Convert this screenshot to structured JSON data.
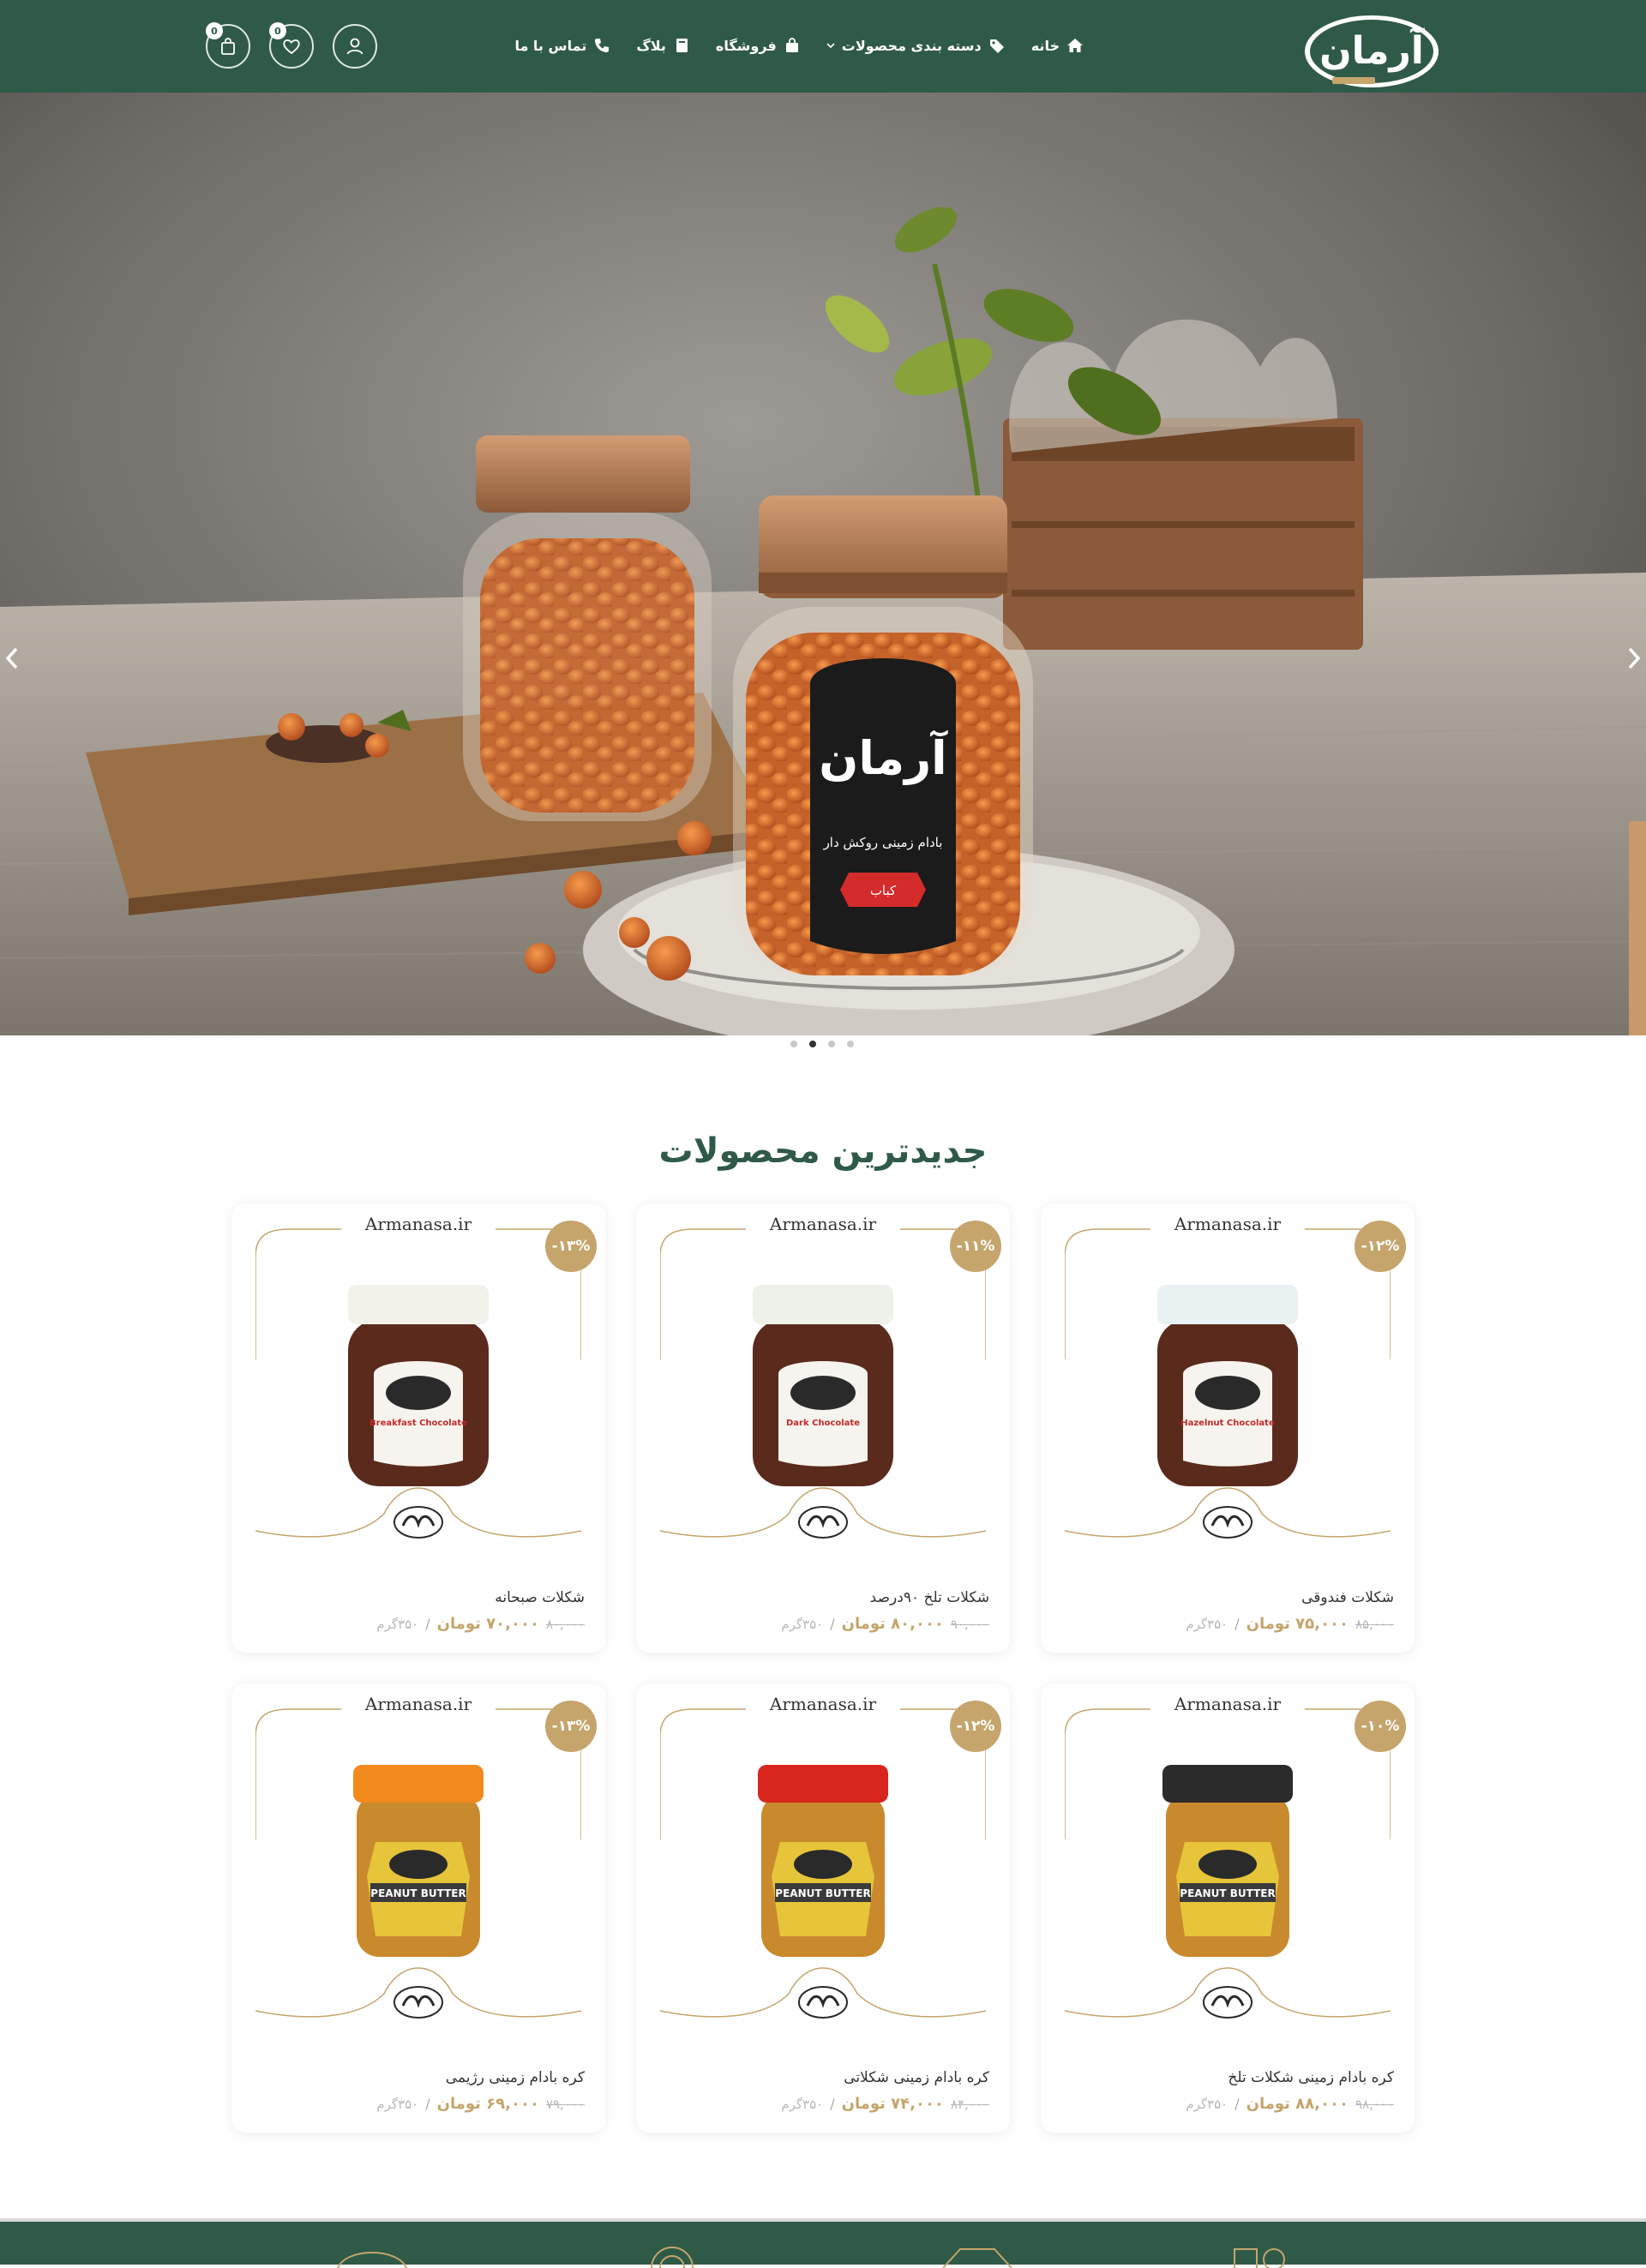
{
  "header": {
    "logo_text": "آرمان",
    "nav": [
      {
        "label": "خانه",
        "icon": "home-icon"
      },
      {
        "label": "دسته بندی محصولات",
        "icon": "tags-icon"
      },
      {
        "label": "فروشگاه",
        "icon": "shopping-bag-icon"
      },
      {
        "label": "بلاگ",
        "icon": "book-icon"
      },
      {
        "label": "تماس با ما",
        "icon": "phone-icon"
      }
    ],
    "wishlist_count": "0",
    "cart_count": "0"
  },
  "hero": {
    "jar_brand": "آرمان",
    "jar_subtitle": "بادام زمینی روکش دار",
    "jar_tag": "کباب",
    "slide_count": 4,
    "active_slide": 2
  },
  "section": {
    "title": "جدیدترین محصولات"
  },
  "products": [
    {
      "name": "شکلات فندوقی",
      "site": "Armanasa.ir",
      "discount": "-۱۲%",
      "old_price": "۸۵,۰۰۰",
      "new_price": "۷۵,۰۰۰ تومان",
      "weight": "۳۵۰گرم",
      "jar": "chocolate",
      "jar_label": "Hazelnut Chocolate",
      "cap_color": "#e9f1f3"
    },
    {
      "name": "شکلات تلخ ۹۰درصد",
      "site": "Armanasa.ir",
      "discount": "-۱۱%",
      "old_price": "۹۰,۰۰۰",
      "new_price": "۸۰,۰۰۰ تومان",
      "weight": "۳۵۰گرم",
      "jar": "chocolate",
      "jar_label": "Dark Chocolate",
      "cap_color": "#eef1ea"
    },
    {
      "name": "شکلات صبحانه",
      "site": "Armanasa.ir",
      "discount": "-۱۳%",
      "old_price": "۸۰,۰۰۰",
      "new_price": "۷۰,۰۰۰ تومان",
      "weight": "۳۵۰گرم",
      "jar": "chocolate",
      "jar_label": "Breakfast Chocolate",
      "cap_color": "#f2f2ea"
    },
    {
      "name": "کره بادام زمینی شکلات تلخ",
      "site": "Armanasa.ir",
      "discount": "-۱۰%",
      "old_price": "۹۸,۰۰۰",
      "new_price": "۸۸,۰۰۰ تومان",
      "weight": "۳۵۰گرم",
      "jar": "peanut",
      "jar_label": "PEANUT BUTTER",
      "cap_color": "#2b2b2b"
    },
    {
      "name": "کره بادام زمینی شکلاتی",
      "site": "Armanasa.ir",
      "discount": "-۱۲%",
      "old_price": "۸۴,۰۰۰",
      "new_price": "۷۴,۰۰۰ تومان",
      "weight": "۳۵۰گرم",
      "jar": "peanut",
      "jar_label": "PEANUT BUTTER",
      "cap_color": "#d8261f"
    },
    {
      "name": "کره بادام زمینی رژیمی",
      "site": "Armanasa.ir",
      "discount": "-۱۳%",
      "old_price": "۷۹,۰۰۰",
      "new_price": "۶۹,۰۰۰ تومان",
      "weight": "۳۵۰گرم",
      "jar": "peanut",
      "jar_label": "PEANUT BUTTER",
      "cap_color": "#f08a1c"
    }
  ],
  "colors": {
    "brand_green": "#2f5a48",
    "accent_gold": "#c5a56c",
    "price_gold": "#c5a56c"
  }
}
